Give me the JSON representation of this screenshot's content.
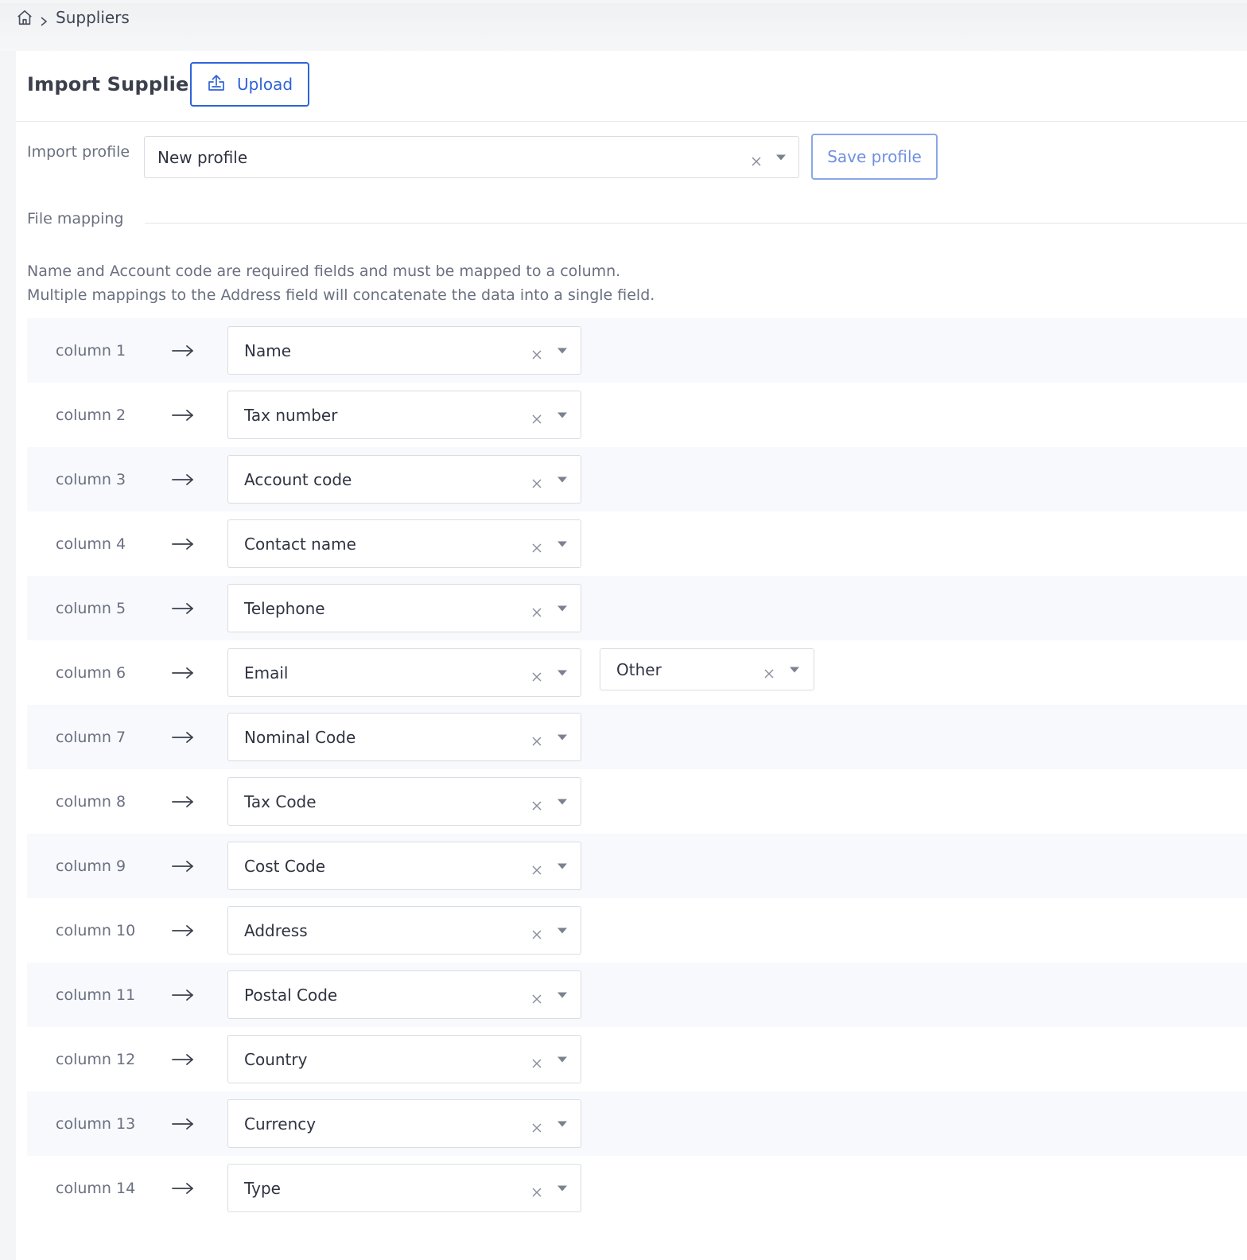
{
  "breadcrumb": {
    "current": "Suppliers"
  },
  "header": {
    "title": "Import Suppliers",
    "upload_label": "Upload"
  },
  "profile": {
    "label": "Import profile",
    "value": "New profile",
    "save_label": "Save profile"
  },
  "mapping": {
    "label": "File mapping",
    "info_line1": "Name and Account code are required fields and must be mapped to a column.",
    "info_line2": "Multiple mappings to the Address field will concatenate the data into a single field.",
    "rows": [
      {
        "column": "column 1",
        "field": "Name"
      },
      {
        "column": "column 2",
        "field": "Tax number"
      },
      {
        "column": "column 3",
        "field": "Account code"
      },
      {
        "column": "column 4",
        "field": "Contact name"
      },
      {
        "column": "column 5",
        "field": "Telephone"
      },
      {
        "column": "column 6",
        "field": "Email",
        "sub_field": "Other"
      },
      {
        "column": "column 7",
        "field": "Nominal Code"
      },
      {
        "column": "column 8",
        "field": "Tax Code"
      },
      {
        "column": "column 9",
        "field": "Cost Code"
      },
      {
        "column": "column 10",
        "field": "Address"
      },
      {
        "column": "column 11",
        "field": "Postal Code"
      },
      {
        "column": "column 12",
        "field": "Country"
      },
      {
        "column": "column 13",
        "field": "Currency"
      },
      {
        "column": "column 14",
        "field": "Type"
      }
    ]
  },
  "colors": {
    "accent": "#2f63d8",
    "accent_light": "#6f8fe0",
    "row_alt": "#f7f9fc"
  }
}
